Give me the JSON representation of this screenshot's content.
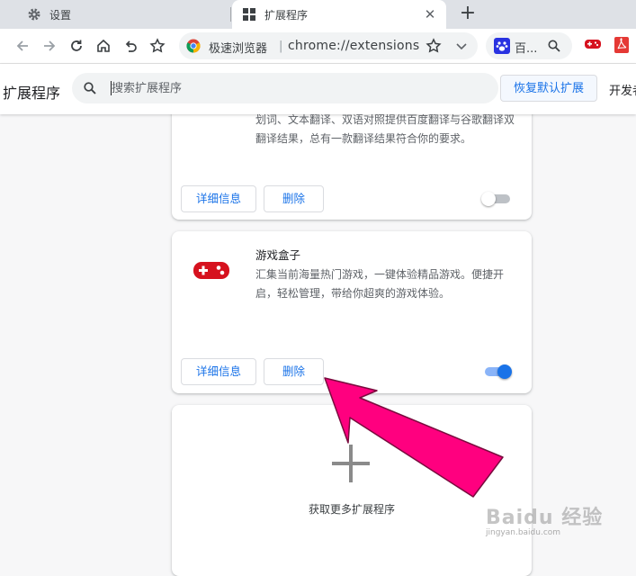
{
  "tabs": [
    {
      "title": "设置",
      "icon": "gear-icon"
    },
    {
      "title": "扩展程序",
      "icon": "extensions-icon"
    }
  ],
  "toolbar": {
    "browser_name": "极速浏览器",
    "separator": "|",
    "url": "chrome://extensions",
    "search_engine_label": "百..."
  },
  "extensions_page": {
    "title": "扩展程序",
    "search_placeholder": "搜索扩展程序",
    "restore_defaults_label": "恢复默认扩展",
    "developer_mode_label": "开发者"
  },
  "extensions": [
    {
      "name": "",
      "description": "划词、文本翻译、双语对照提供百度翻译与谷歌翻译双翻译结果，总有一款翻译结果符合你的要求。",
      "details_label": "详细信息",
      "remove_label": "删除",
      "enabled": false
    },
    {
      "name": "游戏盒子",
      "description": "汇集当前海量热门游戏，一键体验精品游戏。便捷开启，轻松管理，带给你超爽的游戏体验。",
      "details_label": "详细信息",
      "remove_label": "删除",
      "enabled": true,
      "icon": "gamepad-icon",
      "icon_color": "#d6111e"
    }
  ],
  "get_more_label": "获取更多扩展程序",
  "annotation": {
    "color": "#ff007f",
    "points_to": "remove-button"
  },
  "watermark": {
    "brand": "Baidu 经验",
    "url": "jingyan.baidu.com"
  },
  "colors": {
    "accent": "#1a73e8",
    "tabstrip": "#dee1e6"
  }
}
